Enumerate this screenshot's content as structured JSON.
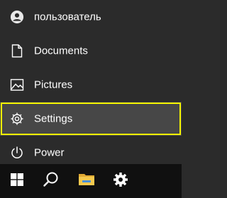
{
  "menu": {
    "items": [
      {
        "label": "пользователь",
        "icon": "user-avatar-icon"
      },
      {
        "label": "Documents",
        "icon": "document-icon"
      },
      {
        "label": "Pictures",
        "icon": "picture-icon"
      },
      {
        "label": "Settings",
        "icon": "gear-icon",
        "selected": true
      },
      {
        "label": "Power",
        "icon": "power-icon"
      }
    ]
  },
  "taskbar": {
    "buttons": [
      {
        "name": "start",
        "icon": "windows-logo-icon"
      },
      {
        "name": "search",
        "icon": "search-icon"
      },
      {
        "name": "file-explorer",
        "icon": "folder-icon"
      },
      {
        "name": "settings",
        "icon": "gear-icon"
      }
    ]
  },
  "colors": {
    "menu_background": "#2b2b2b",
    "selected_background": "#474747",
    "focus_outline": "#f5f500",
    "taskbar_background": "#101010",
    "folder_yellow": "#f0c24a"
  }
}
